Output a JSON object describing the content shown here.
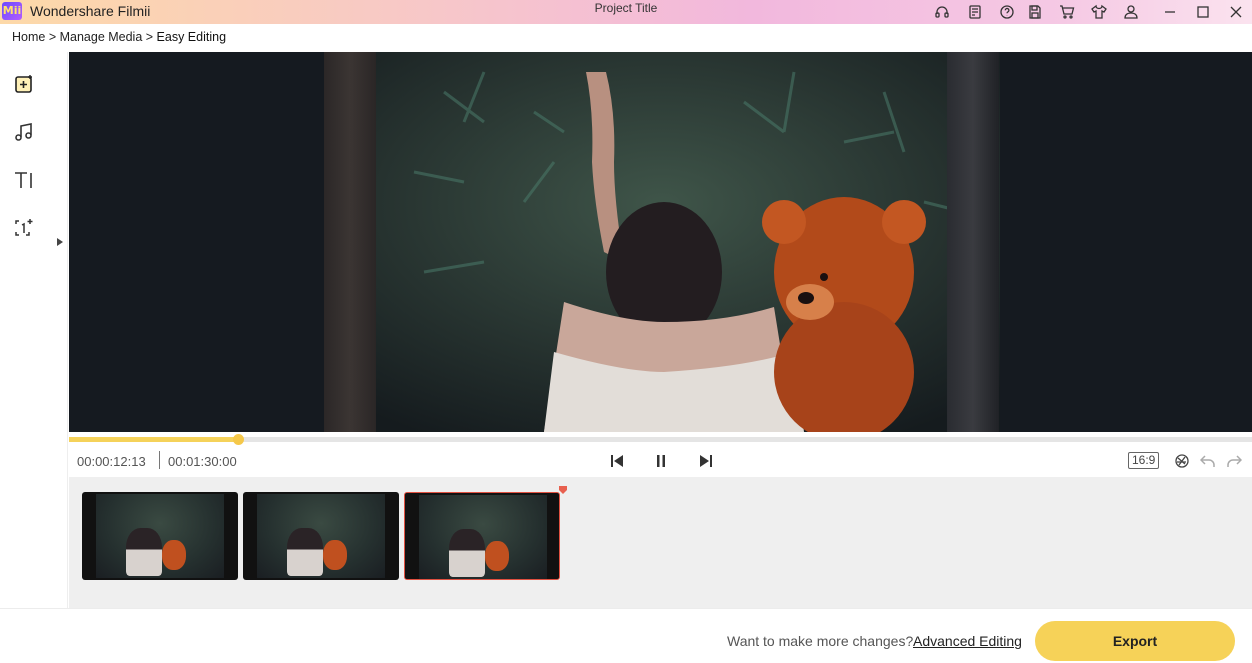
{
  "window": {
    "app_name": "Wondershare Filmii",
    "logo_text": "Mii",
    "project_title": "Project Title",
    "title_icons": [
      "headset-icon",
      "notes-icon",
      "help-icon",
      "save-icon",
      "cart-icon",
      "tshirt-icon",
      "user-icon",
      "minimize-icon",
      "maximize-icon",
      "close-icon"
    ]
  },
  "breadcrumb": {
    "home": "Home",
    "sep1": " > ",
    "manage": "Manage Media",
    "sep2": " > ",
    "current": "Easy Editing"
  },
  "sidebar": {
    "items": [
      "add-media-icon",
      "music-icon",
      "text-icon",
      "sticker-icon"
    ],
    "expand": "expand-arrow-icon"
  },
  "player": {
    "current_time": "00:00:12:13",
    "total_time": "00:01:30:00",
    "progress_fraction": 0.143,
    "aspect_ratio": "16:9",
    "controls": [
      "skip-back-icon",
      "pause-icon",
      "skip-forward-icon"
    ],
    "right_icons": [
      "effects-icon",
      "undo-icon",
      "redo-icon"
    ]
  },
  "timeline": {
    "clips": [
      {
        "name": "clip-1",
        "selected": false
      },
      {
        "name": "clip-2",
        "selected": false
      },
      {
        "name": "clip-3",
        "selected": true
      }
    ]
  },
  "footer": {
    "prompt": "Want to make more changes?",
    "advanced_link": "Advanced Editing",
    "export_label": "Export"
  },
  "colors": {
    "accent": "#f6d258",
    "preview_bg": "#151a20",
    "playhead": "#e05040"
  }
}
